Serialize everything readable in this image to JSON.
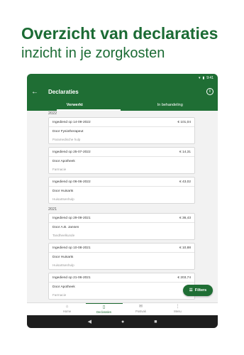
{
  "promo": {
    "headline": "Overzicht van declaraties",
    "subline": "inzicht in je zorgkosten"
  },
  "statusbar": {
    "time": "9:41"
  },
  "appbar": {
    "title": "Declaraties",
    "back_icon": "arrow-left-icon",
    "info_icon": "info-icon"
  },
  "tabs": [
    {
      "label": "Verwerkt",
      "active": true
    },
    {
      "label": "In behandeling",
      "active": false
    }
  ],
  "groups": [
    {
      "year": "2022",
      "items": [
        {
          "date": "Ingediend op 14-09-2022",
          "amount": "€ 101,04",
          "by": "Door Fysiotherapeut",
          "category": "Paramedische hulp"
        },
        {
          "date": "Ingediend op 25-07-2022",
          "amount": "€ 14,31",
          "by": "Door Apotheek",
          "category": "Farmacie"
        },
        {
          "date": "Ingediend op 06-06-2022",
          "amount": "€ 43,02",
          "by": "Door Huisarts",
          "category": "Huisartsenhulp"
        }
      ]
    },
    {
      "year": "2021",
      "items": [
        {
          "date": "Ingediend op 29-09-2021",
          "amount": "€ 36,43",
          "by": "Door A.B. Jansen",
          "category": "Tandheelkunde"
        },
        {
          "date": "Ingediend op 10-08-2021",
          "amount": "€ 10,88",
          "by": "Door Huisarts",
          "category": "Huisartsenhulp"
        },
        {
          "date": "Ingediend op 21-06-2021",
          "amount": "€ 203,74",
          "by": "Door Apotheek",
          "category": "Farmacie"
        }
      ]
    }
  ],
  "fab": {
    "label": "Filters",
    "icon": "filter-icon"
  },
  "bottomnav": [
    {
      "label": "Home",
      "icon": "home-icon",
      "active": false
    },
    {
      "label": "Declaraties",
      "icon": "document-icon",
      "active": true
    },
    {
      "label": "Postvak",
      "icon": "mail-icon",
      "active": false
    },
    {
      "label": "Menu",
      "icon": "more-vertical-icon",
      "active": false
    }
  ],
  "colors": {
    "brand_green": "#1f6e34",
    "headline_green": "#1b6b34"
  }
}
